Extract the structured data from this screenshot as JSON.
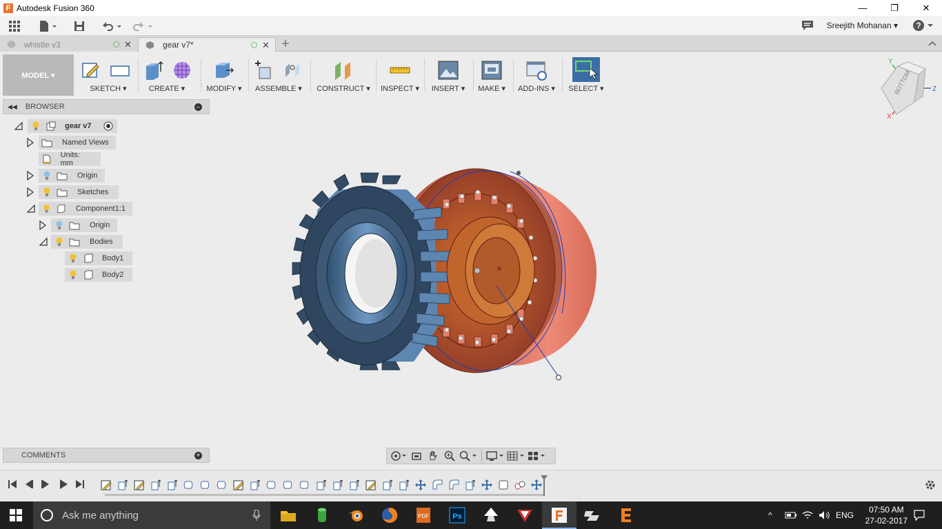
{
  "window": {
    "title": "Autodesk Fusion 360",
    "min": "—",
    "restore": "❐",
    "close": "✕"
  },
  "qat": {
    "user": "Sreejith Mohanan ▾",
    "help": "? ▾"
  },
  "tabs": [
    {
      "label": "whistle v3",
      "active": false
    },
    {
      "label": "gear v7*",
      "active": true
    }
  ],
  "toolbar": {
    "workspace": "MODEL ▾",
    "groups": [
      {
        "label": "SKETCH ▾"
      },
      {
        "label": "CREATE ▾"
      },
      {
        "label": "MODIFY ▾"
      },
      {
        "label": "ASSEMBLE ▾"
      },
      {
        "label": "CONSTRUCT ▾"
      },
      {
        "label": "INSPECT ▾"
      },
      {
        "label": "INSERT ▾"
      },
      {
        "label": "MAKE ▾"
      },
      {
        "label": "ADD-INS ▾"
      },
      {
        "label": "SELECT ▾"
      }
    ]
  },
  "browser": {
    "title": "BROWSER",
    "root": "gear v7",
    "items": [
      {
        "label": "Named Views"
      },
      {
        "label": "Units: mm"
      },
      {
        "label": "Origin"
      },
      {
        "label": "Sketches"
      },
      {
        "label": "Component1:1"
      },
      {
        "label": "Origin"
      },
      {
        "label": "Bodies"
      },
      {
        "label": "Body1"
      },
      {
        "label": "Body2"
      }
    ]
  },
  "comments": {
    "title": "COMMENTS"
  },
  "viewcube": {
    "face": "BOTTOM",
    "axes": {
      "x": "X",
      "y": "Y",
      "z": "Z"
    }
  },
  "taskbar": {
    "search_placeholder": "Ask me anything",
    "language": "ENG",
    "time": "07:50 AM",
    "date": "27-02-2017"
  },
  "colors": {
    "accent": "#3c6ea5",
    "gear_blue": "#3a5f86",
    "gear_copper": "#b5592f",
    "cylinder": "#e07765"
  }
}
